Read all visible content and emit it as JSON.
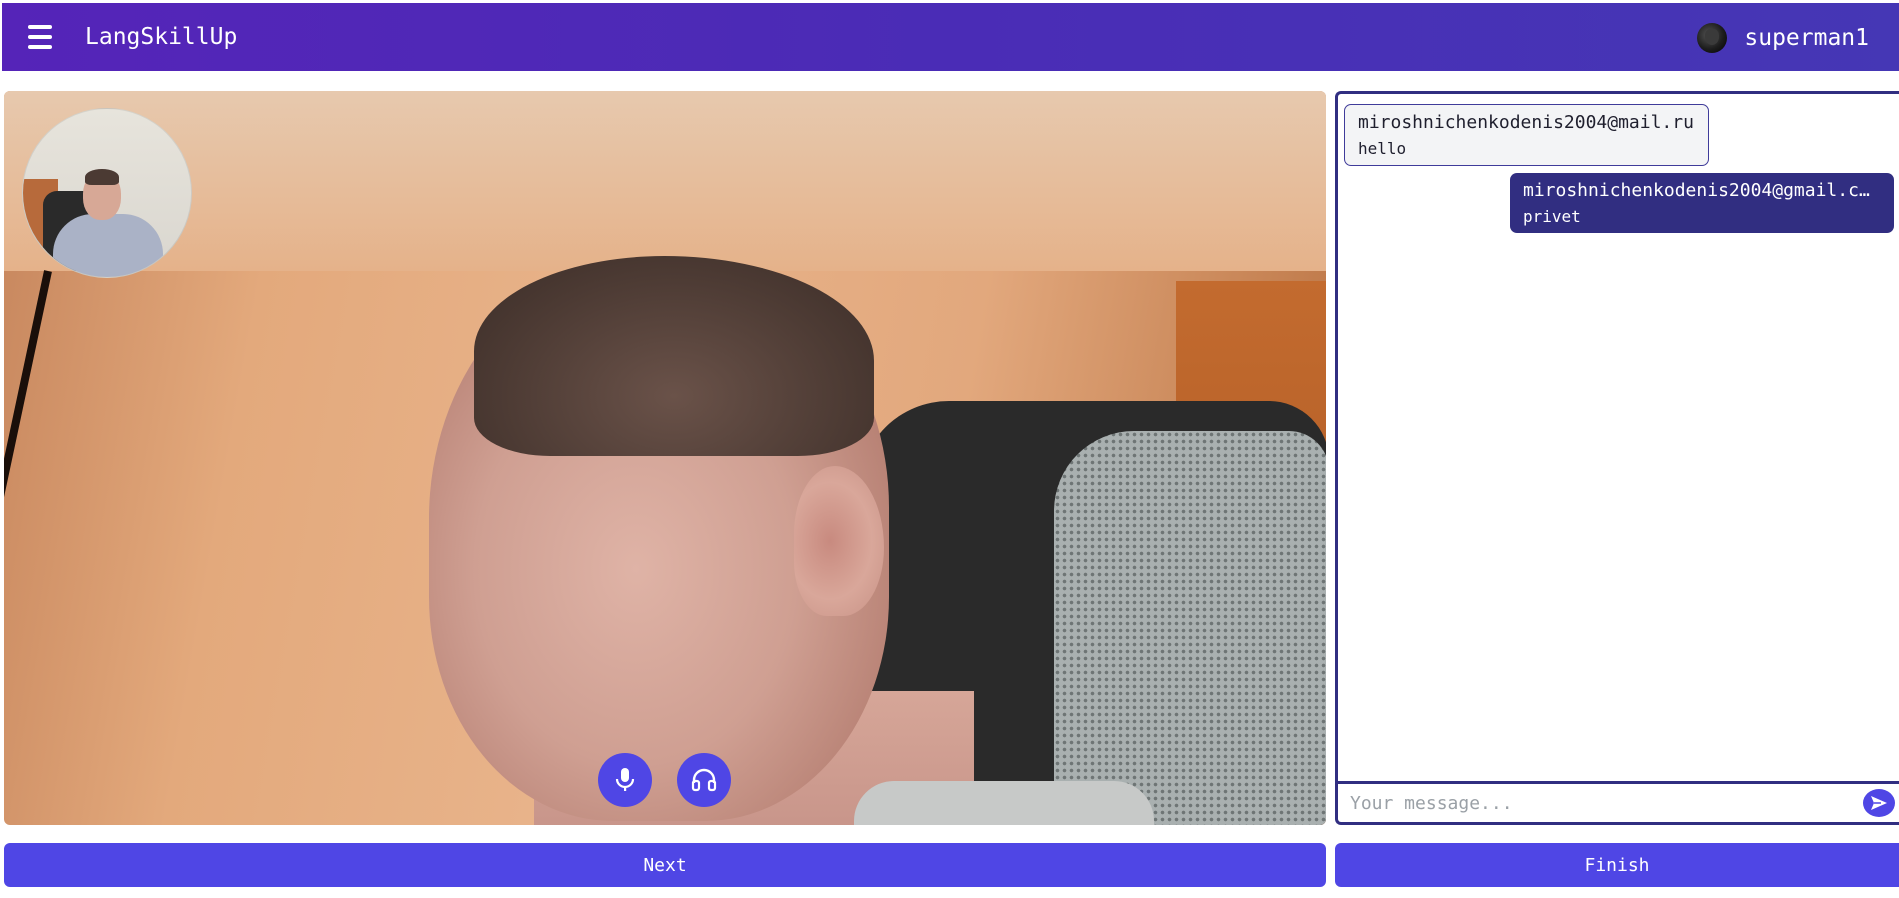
{
  "header": {
    "app_title": "LangSkillUp",
    "username": "superman1"
  },
  "video": {
    "controls": [
      {
        "icon": "microphone-icon"
      },
      {
        "icon": "headphones-icon"
      }
    ]
  },
  "chat": {
    "messages": [
      {
        "author": "miroshnichenkodenis2004@mail.ru",
        "text": "hello",
        "direction": "incoming"
      },
      {
        "author": "miroshnichenkodenis2004@gmail.c…",
        "text": "privet",
        "direction": "outgoing"
      }
    ],
    "input_value": "",
    "input_placeholder": "Your message..."
  },
  "actions": {
    "next_label": "Next",
    "finish_label": "Finish"
  },
  "colors": {
    "header_gradient_start": "#5524b8",
    "header_gradient_end": "#4537b5",
    "accent": "#4f46e5",
    "chat_border": "#312e81",
    "outgoing_bubble": "#312e81",
    "incoming_bubble": "#f3f4f6"
  }
}
